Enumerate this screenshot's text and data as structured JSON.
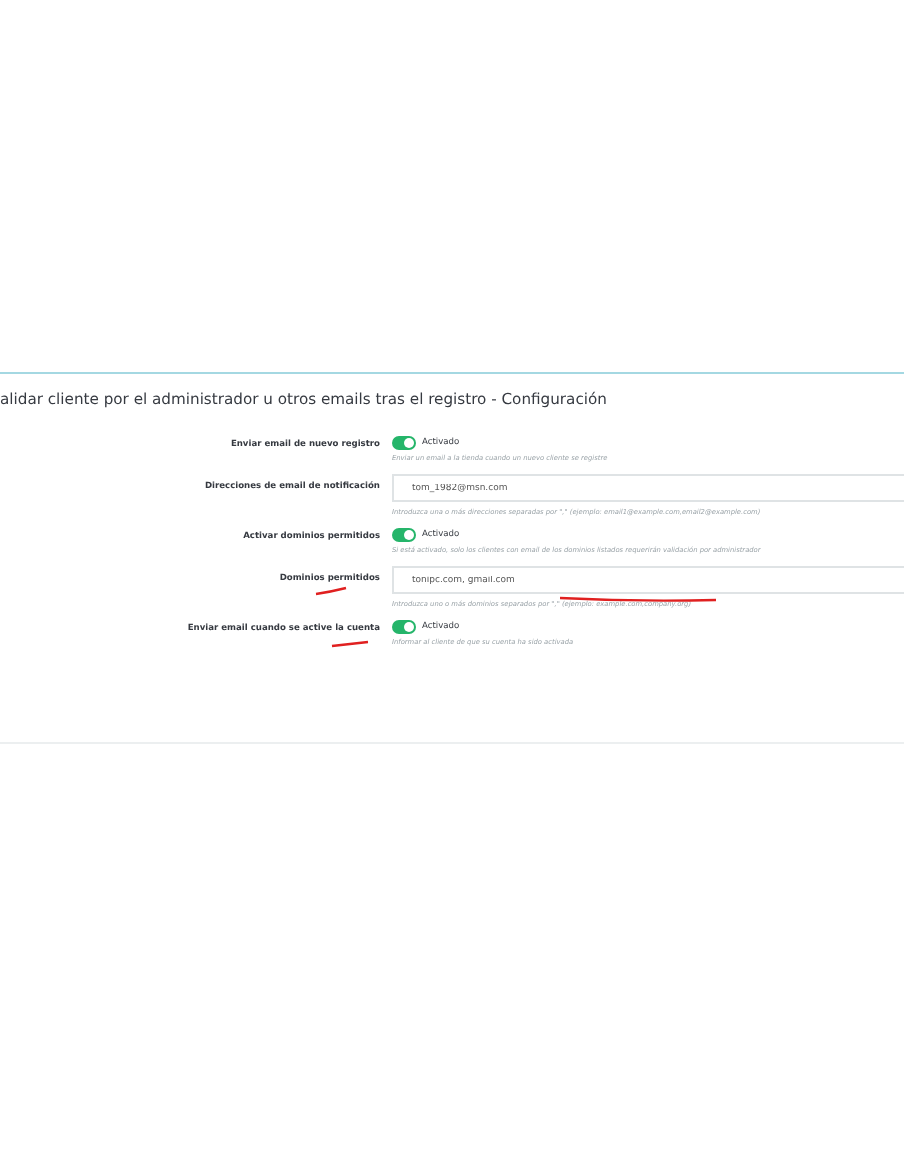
{
  "card": {
    "title": "alidar cliente por el administrador u otros emails tras el registro - Configuración"
  },
  "settings": [
    {
      "kind": "switch",
      "label": "Enviar email de nuevo registro",
      "on": true,
      "state_text": "Activado",
      "help": "Enviar un email a la tienda cuando un nuevo cliente se registre"
    },
    {
      "kind": "text",
      "label": "Direcciones de email de notificación",
      "value": "tom_1982@msn.com",
      "help": "Introduzca una o más direcciones separadas por \",\" (ejemplo: email1@example.com,email2@example.com)"
    },
    {
      "kind": "switch",
      "label": "Activar dominios permitidos",
      "on": true,
      "state_text": "Activado",
      "help": "Si está activado, solo los clientes con email de los dominios listados requerirán validación por administrador"
    },
    {
      "kind": "text",
      "label": "Dominios permitidos",
      "value": "tonipc.com, gmail.com",
      "help": "Introduzca uno o más dominios separados por \",\" (ejemplo: example.com,company.org)"
    },
    {
      "kind": "switch",
      "label": "Enviar email cuando se active la cuenta",
      "on": true,
      "state_text": "Activado",
      "help": "Informar al cliente de que su cuenta ha sido activada"
    }
  ]
}
